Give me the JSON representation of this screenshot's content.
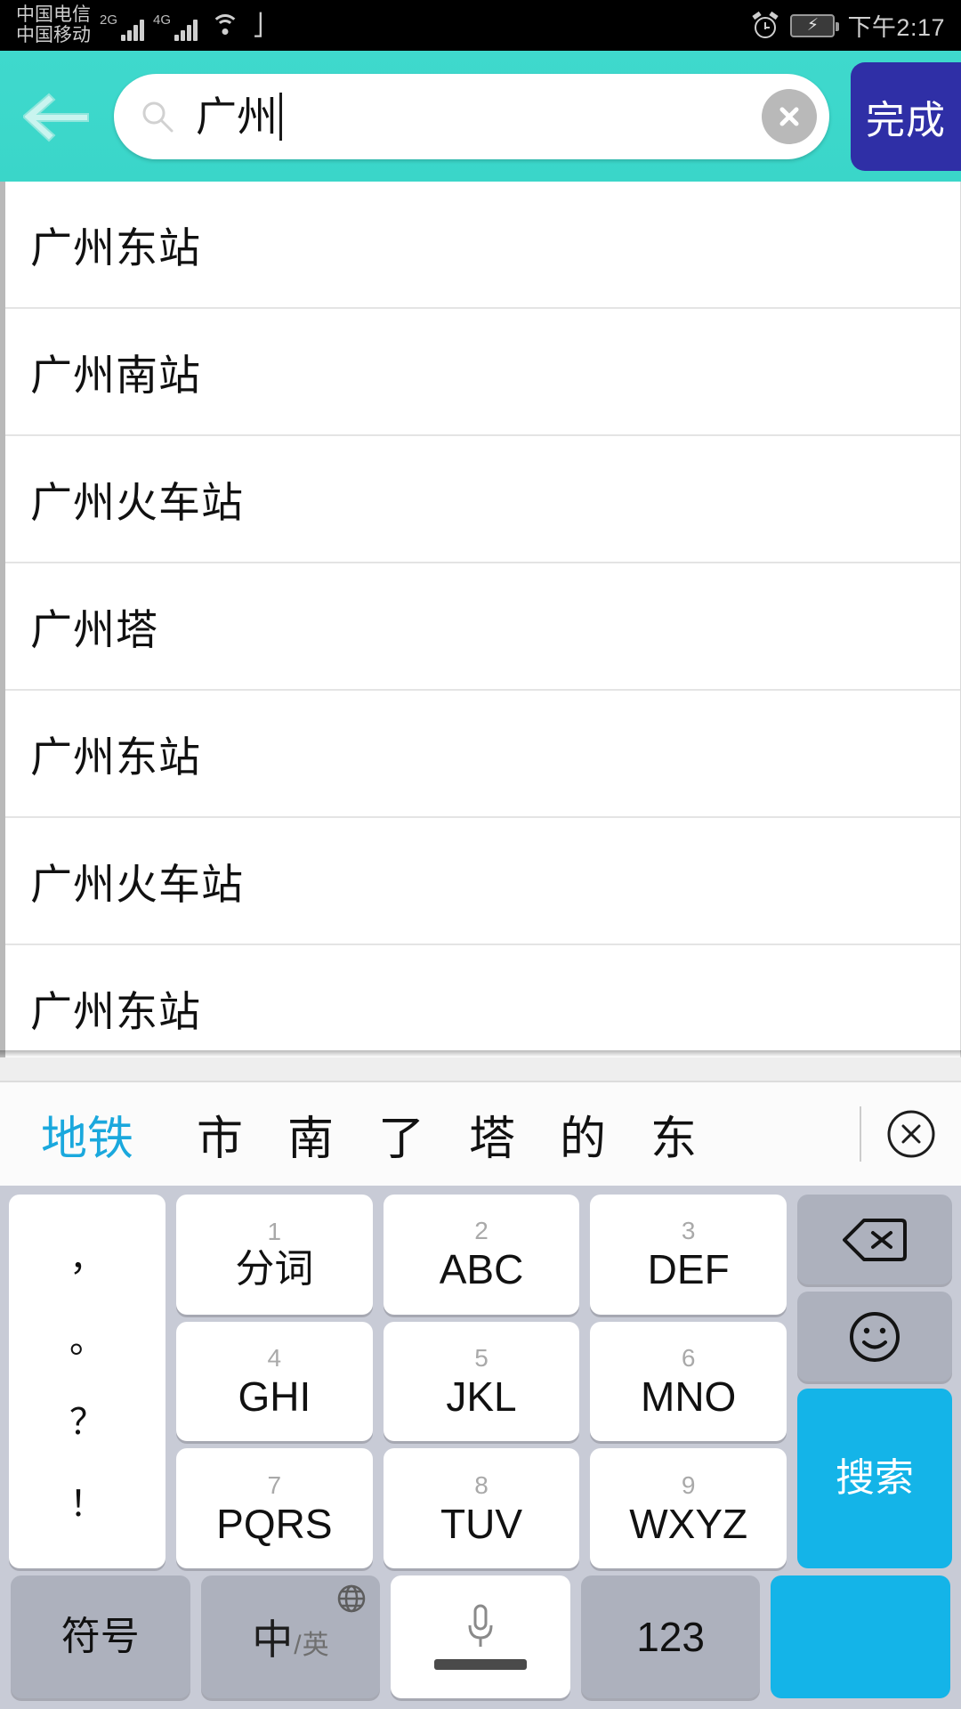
{
  "status_bar": {
    "carrier_primary": "中国电信",
    "carrier_secondary": "中国移动",
    "network_primary": "2G",
    "network_secondary": "4G",
    "icons": [
      "wifi-icon",
      "usb-icon",
      "alarm-icon",
      "battery-charging-icon"
    ],
    "time": "下午2:17"
  },
  "header": {
    "background_color": "#3ad6c9",
    "back_icon": "back-arrow-icon",
    "search": {
      "icon": "search-icon",
      "value": "广州",
      "placeholder": "",
      "clear_icon": "clear-circle-icon"
    },
    "done_label": "完成",
    "done_color": "#2f2fa6"
  },
  "suggestions": [
    {
      "label": "广州东站"
    },
    {
      "label": "广州南站"
    },
    {
      "label": "广州火车站"
    },
    {
      "label": "广州塔"
    },
    {
      "label": "广州东站"
    },
    {
      "label": "广州火车站"
    },
    {
      "label": "广州东站"
    }
  ],
  "candidate_bar": {
    "highlight_color": "#1aa8dd",
    "items": [
      "地铁",
      "市",
      "南",
      "了",
      "塔",
      "的",
      "东"
    ],
    "close_icon": "close-circle-icon"
  },
  "keyboard": {
    "punctuation": [
      "，",
      "。",
      "？",
      "！"
    ],
    "rows": [
      [
        {
          "num": "1",
          "label": "分词",
          "style": "light"
        },
        {
          "num": "2",
          "label": "ABC",
          "style": "light"
        },
        {
          "num": "3",
          "label": "DEF",
          "style": "light"
        }
      ],
      [
        {
          "num": "4",
          "label": "GHI",
          "style": "light"
        },
        {
          "num": "5",
          "label": "JKL",
          "style": "light"
        },
        {
          "num": "6",
          "label": "MNO",
          "style": "light"
        }
      ],
      [
        {
          "num": "7",
          "label": "PQRS",
          "style": "light"
        },
        {
          "num": "8",
          "label": "TUV",
          "style": "light"
        },
        {
          "num": "9",
          "label": "WXYZ",
          "style": "light"
        }
      ]
    ],
    "right_column": [
      {
        "icon": "backspace-icon",
        "style": "dark"
      },
      {
        "icon": "emoji-icon",
        "style": "dark"
      },
      {
        "label": "搜索",
        "style": "accent"
      }
    ],
    "bottom_row": {
      "symbols_label": "符号",
      "lang_main": "中",
      "lang_slash": "/",
      "lang_sub": "英",
      "lang_icon": "globe-icon",
      "space_icon": "microphone-icon",
      "numbers_label": "123"
    },
    "accent_color": "#14b4e8"
  }
}
